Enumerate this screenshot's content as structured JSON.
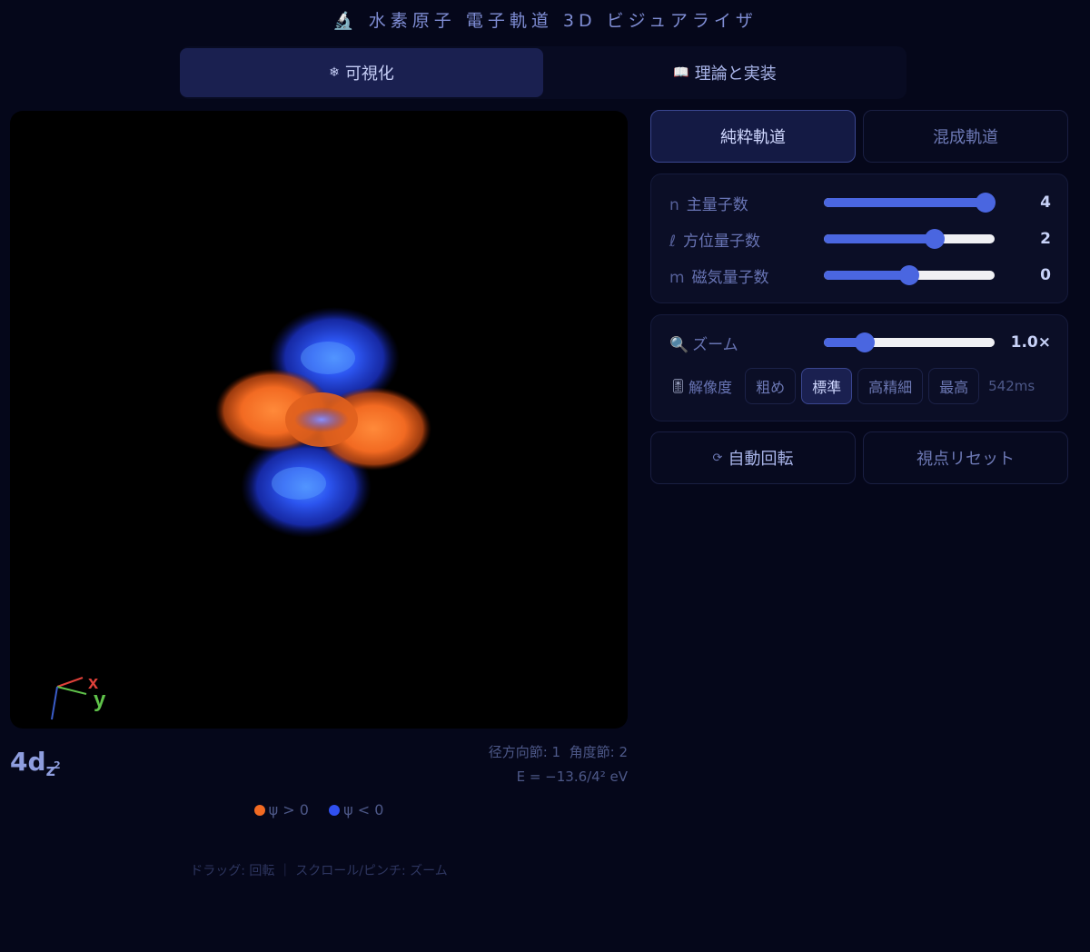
{
  "app": {
    "title_icon": "microscope-icon",
    "title_glyph": "🔬",
    "title": "水素原子 電子軌道 3D ビジュアライザ"
  },
  "tabs": [
    {
      "icon": "snowflake-icon",
      "glyph": "❄",
      "label": "可視化",
      "active": true
    },
    {
      "icon": "book-icon",
      "glyph": "📖",
      "label": "理論と実装",
      "active": false
    }
  ],
  "viewer": {
    "axes": {
      "x_label": "x",
      "y_label": "y",
      "x_color": "#e0413a",
      "y_color": "#5fc24a",
      "z_color": "#3a5cc8"
    }
  },
  "orbital": {
    "name_main": "4d",
    "name_sub": "z",
    "name_sup": "2",
    "nodes": "径方向節: 1  角度節: 2",
    "energy": "E = −13.6/4² eV"
  },
  "legend": {
    "positive": {
      "label": "ψ > 0",
      "color": "#f26a22"
    },
    "negative": {
      "label": "ψ < 0",
      "color": "#3050f0"
    }
  },
  "hint": "ドラッグ: 回転 ｜ スクロール/ピンチ: ズーム",
  "orbital_type": {
    "pure": "純粋軌道",
    "hybrid": "混成軌道",
    "selected": "pure"
  },
  "quantum": [
    {
      "symbol": "n",
      "label": "主量子数",
      "value": "4",
      "fraction": 0.94
    },
    {
      "symbol": "ℓ",
      "label": "方位量子数",
      "value": "2",
      "fraction": 0.65
    },
    {
      "symbol": "m",
      "label": "磁気量子数",
      "value": "0",
      "fraction": 0.5
    }
  ],
  "zoom": {
    "icon": "magnifier-icon",
    "glyph": "🔍",
    "label": "ズーム",
    "value": "1.0×",
    "fraction": 0.24
  },
  "resolution": {
    "icon": "tuning-icon",
    "glyph": "🎚",
    "label": "解像度",
    "options": [
      "粗め",
      "標準",
      "高精細",
      "最高"
    ],
    "selected": 1,
    "time": "542ms"
  },
  "actions": {
    "autorotate_glyph": "⟳",
    "autorotate": "自動回転",
    "reset": "視点リセット"
  },
  "colors": {
    "accent": "#4a66e0",
    "background": "#05071a"
  }
}
